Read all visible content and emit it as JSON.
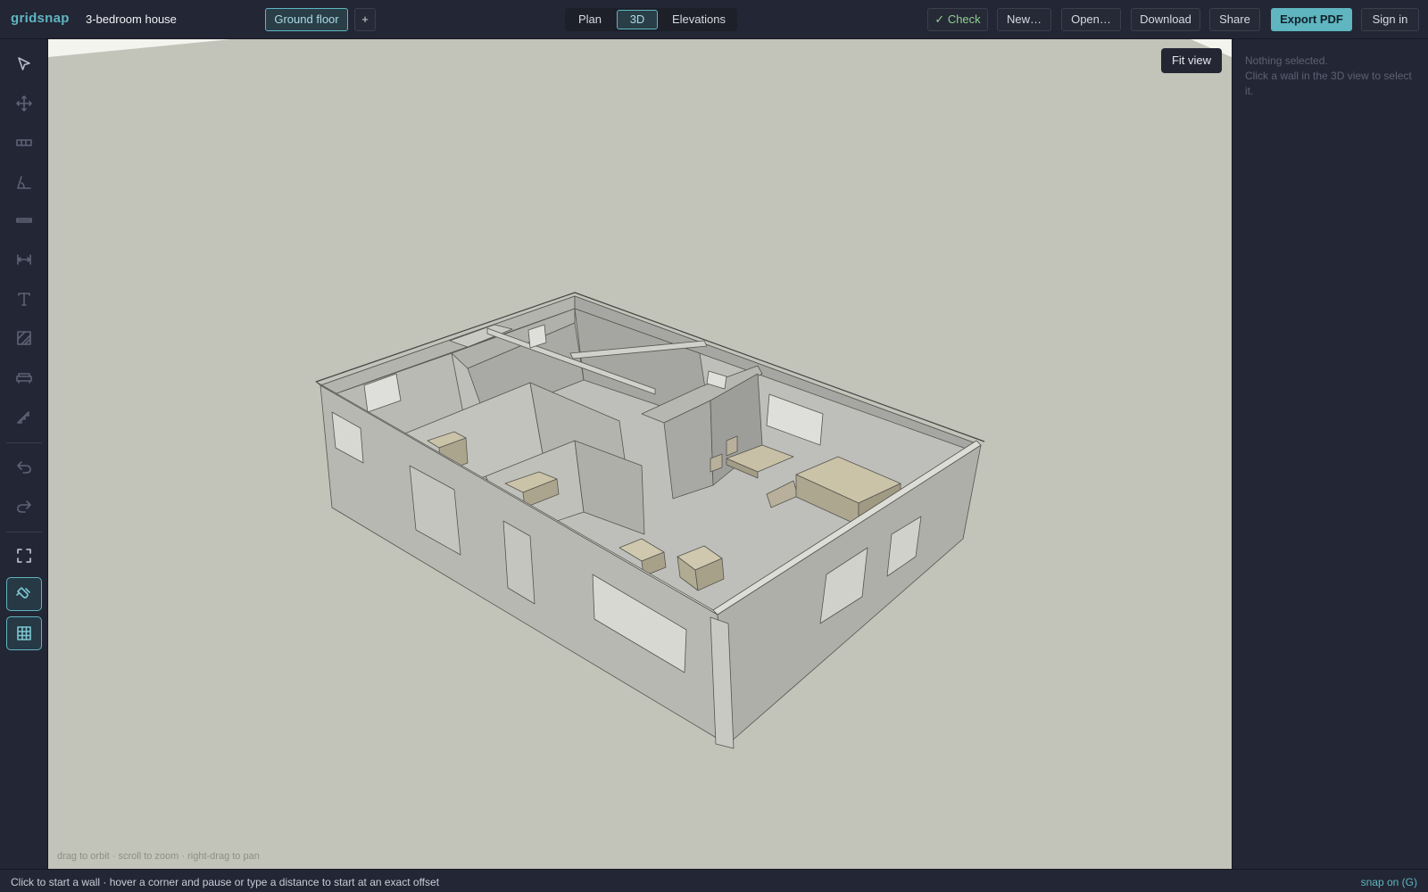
{
  "app": {
    "logo": "gridsnap",
    "project_title": "3-bedroom house"
  },
  "header": {
    "floor_button": "Ground floor",
    "add_floor": "+",
    "view_tabs": {
      "plan": "Plan",
      "threed": "3D",
      "elevations": "Elevations"
    },
    "active_view": "3D",
    "check": "✓ Check",
    "new": "New…",
    "open": "Open…",
    "download": "Download",
    "share": "Share",
    "export_pdf": "Export PDF",
    "sign_in": "Sign in"
  },
  "toolbar": {
    "tools": [
      "select-tool",
      "move-tool",
      "wall-tool",
      "angle-tool",
      "beam-tool",
      "dimension-tool",
      "text-tool",
      "area-tool",
      "furniture-tool",
      "stairs-tool"
    ],
    "actions": [
      "undo",
      "redo",
      "fit-screen",
      "snap-toggle",
      "grid-toggle"
    ],
    "active": [
      "snap-toggle",
      "grid-toggle"
    ]
  },
  "viewport": {
    "fit_view": "Fit view",
    "hint": "drag to orbit · scroll to zoom · right-drag to pan"
  },
  "inspector": {
    "empty_title": "Nothing selected.",
    "empty_help": "Click a wall in the 3D view to select it."
  },
  "status": {
    "message": "Click to start a wall · hover a corner and pause or type a distance to start at an exact offset",
    "snap": "snap on (G)"
  },
  "colors": {
    "accent": "#5fb5c0",
    "chrome": "#232634",
    "viewport_bg": "#c2c3b9",
    "check_ok": "#8fcf8f"
  }
}
